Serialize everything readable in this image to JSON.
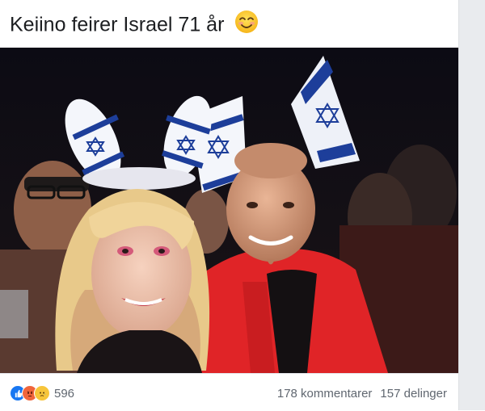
{
  "post": {
    "text": "Keiino feirer Israel 71 år",
    "emoji_icon": "smiling-face-emoji-icon"
  },
  "photo": {
    "description_icon": "photo",
    "colors": {
      "background": "#0b0a10",
      "jacket": "#e02427",
      "flag_blue": "#1d3e9a",
      "hair": "#e8c98a"
    }
  },
  "reactions": {
    "icons": [
      "like-reaction-icon",
      "angry-reaction-icon",
      "sad-reaction-icon"
    ],
    "count": "596"
  },
  "stats": {
    "comments": "178 kommentarer",
    "shares": "157 delinger"
  }
}
